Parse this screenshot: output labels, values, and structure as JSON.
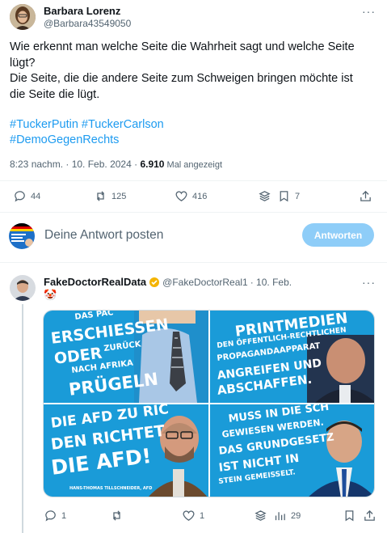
{
  "tweet": {
    "author": "Barbara Lorenz",
    "handle": "@Barbara43549050",
    "more": "···",
    "para1": "Wie erkennt man welche Seite die Wahrheit sagt und welche Seite lügt?",
    "para2": "Die Seite, die die andere Seite zum Schweigen bringen möchte ist die Seite die lügt.",
    "hashtags_line1": "#TuckerPutin #TuckerCarlson",
    "hashtags_line2": "#DemoGegenRechts",
    "time": "8:23 nachm. · 10. Feb. 2024 · ",
    "views_count": "6.910",
    "views_label": " Mal angezeigt",
    "actions": {
      "replies": "44",
      "retweets": "125",
      "likes": "416",
      "bookmarks": "7"
    }
  },
  "composer": {
    "placeholder": "Deine Antwort posten",
    "button": "Antworten"
  },
  "reply": {
    "author": "FakeDoctorRealData",
    "handle": "@FakeDoctorReal1",
    "date": " · 10. Feb.",
    "emoji": "🤡",
    "more": "···",
    "posters": {
      "p1_l1": "DAS PAC",
      "p1_l2": "ERSCHIESSEN",
      "p1_l3": "ODER",
      "p1_l3b": "ZURÜCK",
      "p1_l4": "NACH AFRIKA",
      "p1_l5": "PRÜGELN",
      "p2_l1": "PRINTMEDIEN",
      "p2_l2": "DEN ÖFFENTLICH-RECHTLICHEN",
      "p2_l3": "PROPAGANDAAPPARAT",
      "p2_l4": "ANGREIFEN UND",
      "p2_l5": "ABSCHAFFEN.",
      "p3_l1": "DIE AFD ZU RIC",
      "p3_l2": "DEN RICHTET",
      "p3_l3": "DIE AFD!",
      "p3_caption": "HANS-THOMAS TILLSCHNEIDER, AFD",
      "p4_l1": "MUSS IN DIE SCH",
      "p4_l2": "GEWIESEN WERDEN.",
      "p4_l3": "DAS GRUNDGESETZ",
      "p4_l4": "IST NICHT IN",
      "p4_l5": "STEIN GEMEISSELT."
    },
    "actions": {
      "replies": "1",
      "likes": "1",
      "views": "29"
    }
  },
  "colors": {
    "accent": "#1d9bf0",
    "reply_button": "#8ecdf8",
    "poster_blue": "#1a9bd8"
  }
}
